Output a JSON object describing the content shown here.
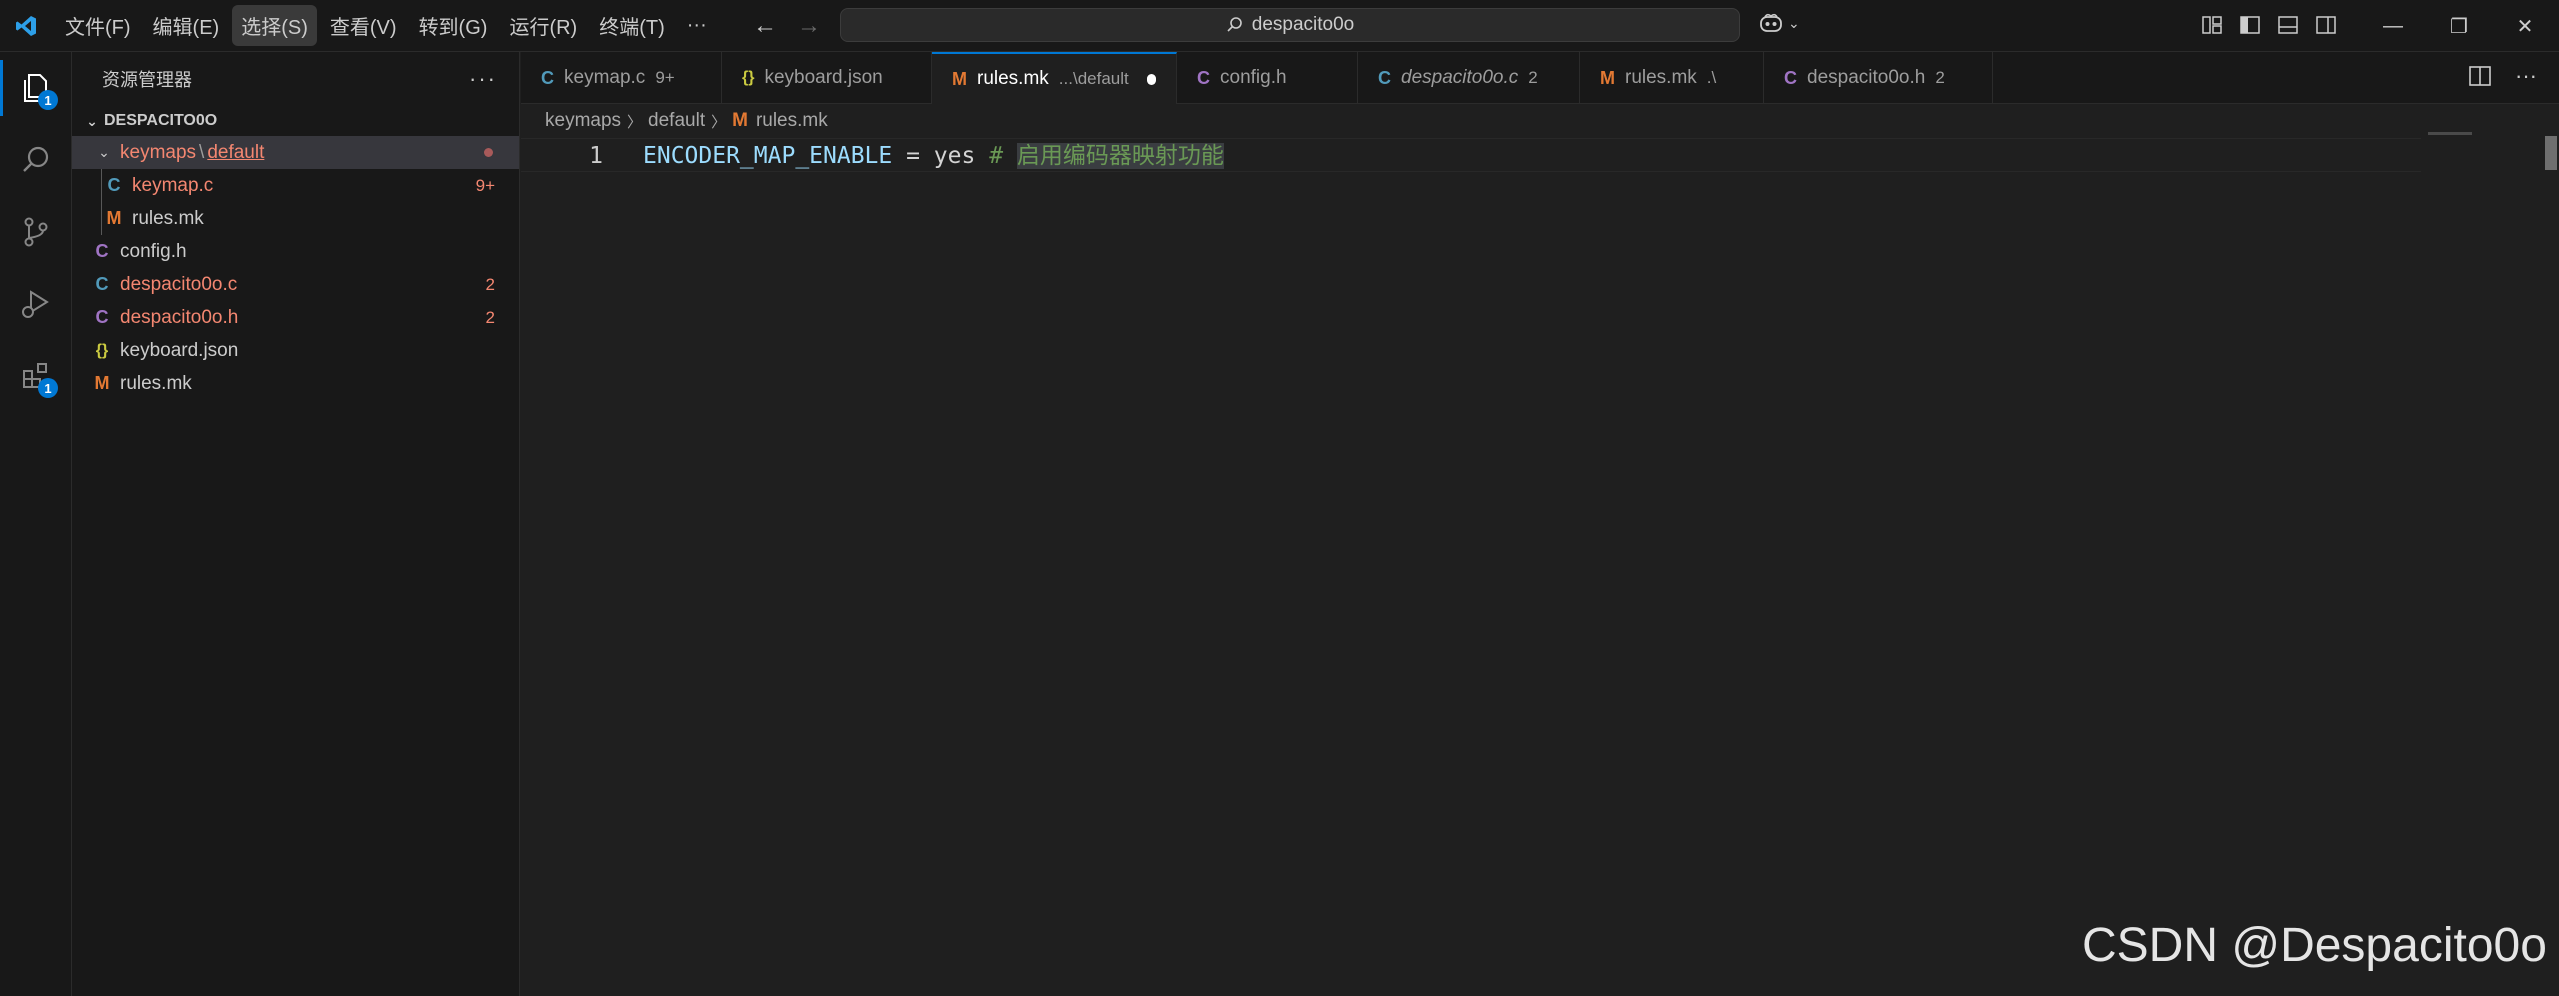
{
  "menu": {
    "items": [
      "文件(F)",
      "编辑(E)",
      "选择(S)",
      "查看(V)",
      "转到(G)",
      "运行(R)",
      "终端(T)"
    ],
    "more": "···",
    "active_index": 2
  },
  "nav": {
    "back_icon": "arrow-left-icon",
    "forward_icon": "arrow-right-icon"
  },
  "search": {
    "text": "despacito0o",
    "icon": "search-icon"
  },
  "window": {
    "minimize": "—",
    "restore": "❐",
    "close": "✕"
  },
  "activity": {
    "explorer_badge": "1",
    "extensions_badge": "1"
  },
  "sidebar": {
    "title": "资源管理器",
    "more": "···",
    "section": "DESPACITO0O",
    "folder": {
      "name": "keymaps",
      "sep": "\\",
      "sub": "default"
    },
    "files_nested": [
      {
        "icon": "C",
        "name": "keymap.c",
        "badge": "9+"
      },
      {
        "icon": "M",
        "name": "rules.mk",
        "badge": ""
      }
    ],
    "files": [
      {
        "icon": "C",
        "name": "config.h",
        "badge": ""
      },
      {
        "icon": "C",
        "name": "despacito0o.c",
        "badge": "2"
      },
      {
        "icon": "C",
        "name": "despacito0o.h",
        "badge": "2"
      },
      {
        "icon": "{}",
        "name": "keyboard.json",
        "badge": ""
      },
      {
        "icon": "M",
        "name": "rules.mk",
        "badge": ""
      }
    ]
  },
  "tabs": [
    {
      "icon": "C",
      "label": "keymap.c",
      "badge": "9+",
      "desc": ""
    },
    {
      "icon": "{}",
      "label": "keyboard.json",
      "badge": "",
      "desc": ""
    },
    {
      "icon": "M",
      "label": "rules.mk",
      "badge": "",
      "desc": "...\\default"
    },
    {
      "icon": "C",
      "label": "config.h",
      "badge": "",
      "desc": ""
    },
    {
      "icon": "C",
      "label": "despacito0o.c",
      "badge": "2",
      "desc": ""
    },
    {
      "icon": "M",
      "label": "rules.mk",
      "badge": "",
      "desc": ".\\"
    },
    {
      "icon": "C",
      "label": "despacito0o.h",
      "badge": "2",
      "desc": ""
    }
  ],
  "breadcrumb": {
    "part1": "keymaps",
    "part2": "default",
    "file_icon": "M",
    "file": "rules.mk"
  },
  "code": {
    "line_number": "1",
    "var": "ENCODER_MAP_ENABLE",
    "op": " = ",
    "value": "yes",
    "hash": " # ",
    "comment": "启用编码器映射功能"
  },
  "colors": {
    "accent": "#0078d4",
    "error": "#f48771",
    "c_icon": "#519aba",
    "h_icon": "#a074c4",
    "json_icon": "#cbcb41",
    "mk_icon": "#e37933"
  },
  "watermark": "CSDN @Despacito0o"
}
